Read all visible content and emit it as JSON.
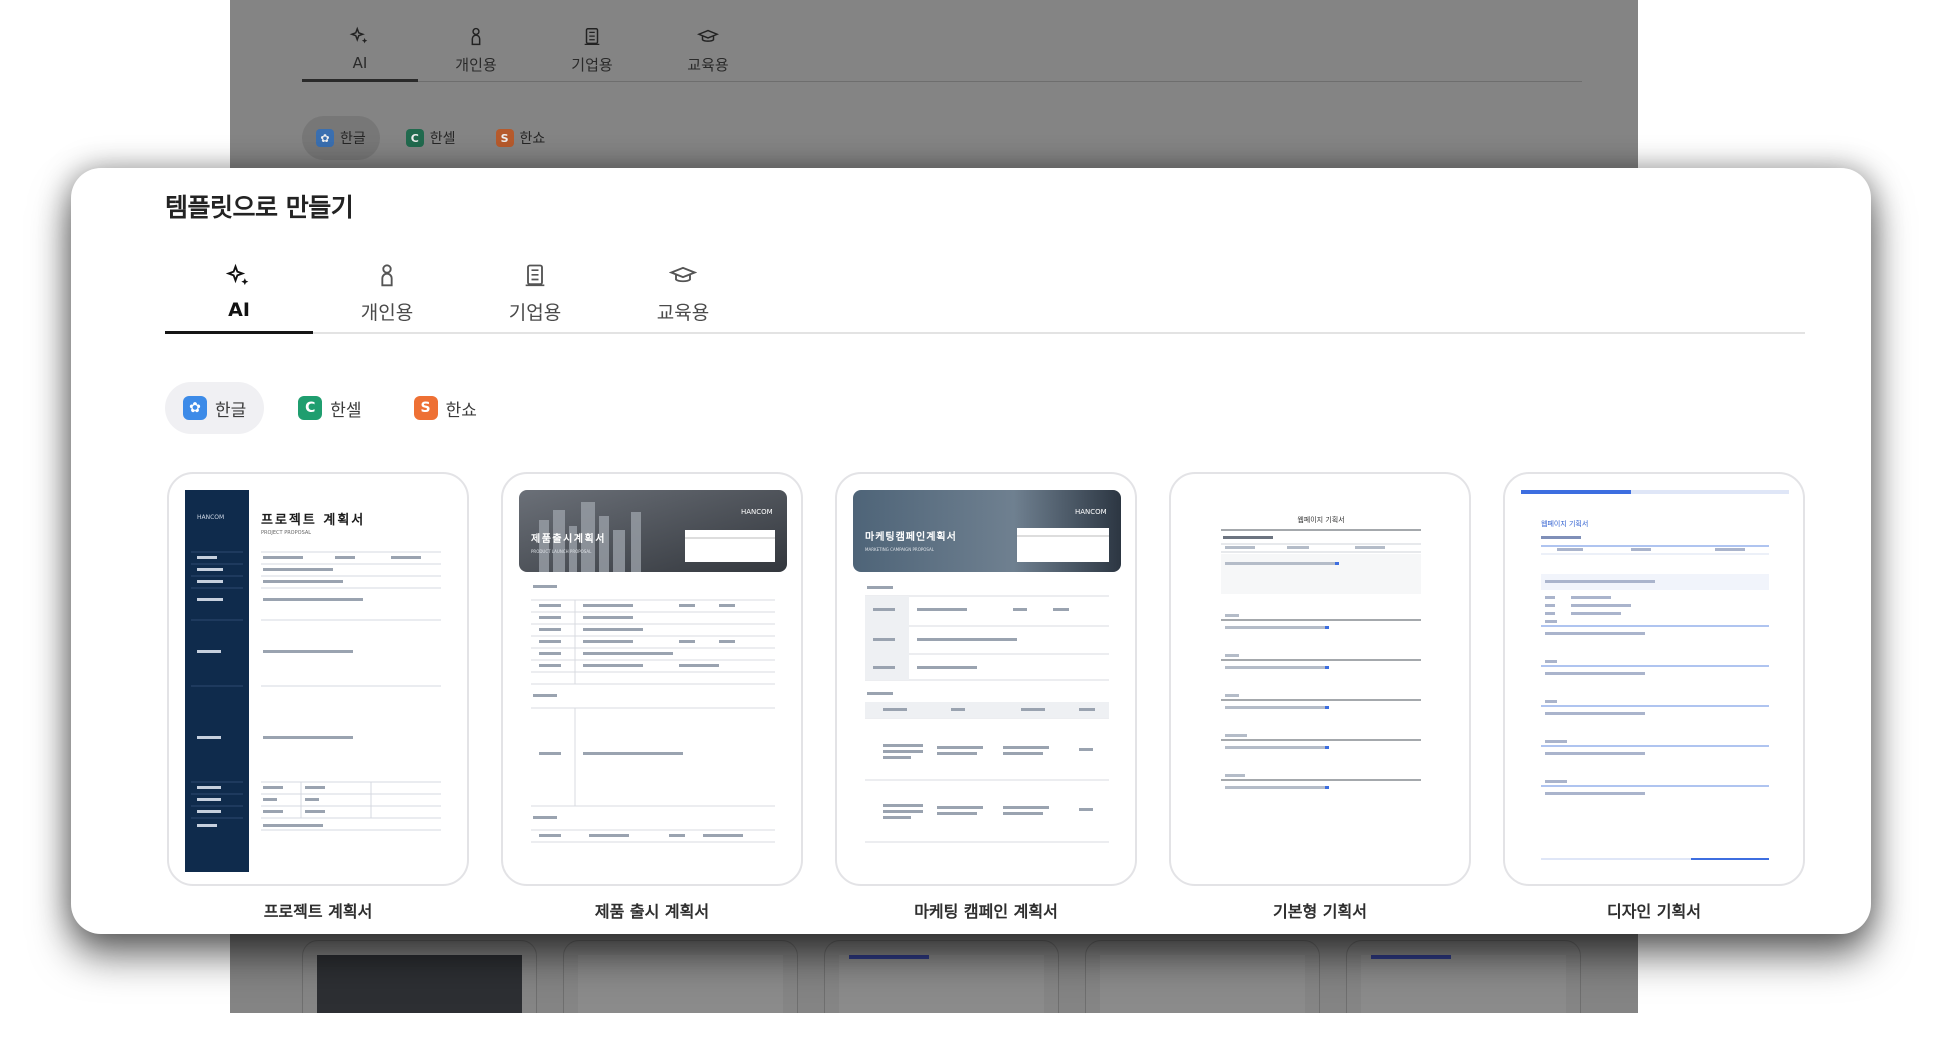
{
  "background": {
    "tabs": [
      {
        "label": "AI",
        "icon": "sparkle-icon"
      },
      {
        "label": "개인용",
        "icon": "person-icon"
      },
      {
        "label": "기업용",
        "icon": "building-icon"
      },
      {
        "label": "교육용",
        "icon": "graduation-cap-icon"
      }
    ],
    "apps": [
      {
        "label": "한글",
        "badge": "✿",
        "color": "#3a6fb0"
      },
      {
        "label": "한셀",
        "badge": "C",
        "color": "#216a4e"
      },
      {
        "label": "한쇼",
        "badge": "S",
        "color": "#b65a2c"
      }
    ]
  },
  "modal": {
    "title": "템플릿으로 만들기",
    "tabs": [
      {
        "label": "AI",
        "icon": "sparkle-icon",
        "active": true
      },
      {
        "label": "개인용",
        "icon": "person-icon",
        "active": false
      },
      {
        "label": "기업용",
        "icon": "building-icon",
        "active": false
      },
      {
        "label": "교육용",
        "icon": "graduation-cap-icon",
        "active": false
      }
    ],
    "apps": [
      {
        "label": "한글",
        "badge": "✿",
        "color": "#3d8be8",
        "active": true
      },
      {
        "label": "한셀",
        "badge": "C",
        "color": "#1f9e6f",
        "active": false
      },
      {
        "label": "한쇼",
        "badge": "S",
        "color": "#ee7034",
        "active": false
      }
    ],
    "templates": [
      {
        "label": "프로젝트 계획서",
        "doc_title": "프로젝트 계획서",
        "doc_subtitle": "PROJECT PROPOSAL",
        "brand": "HANCOM"
      },
      {
        "label": "제품 출시 계획서",
        "doc_title": "제품출시계획서",
        "doc_subtitle": "PRODUCT LAUNCH PROPOSAL",
        "brand": "HANCOM"
      },
      {
        "label": "마케팅 캠페인 계획서",
        "doc_title": "마케팅캠페인계획서",
        "doc_subtitle": "MARKETING CAMPAIGN PROPOSAL",
        "brand": "HANCOM"
      },
      {
        "label": "기본형 기획서",
        "doc_title": "웹페이지 기획서"
      },
      {
        "label": "디자인 기획서",
        "doc_title": "웹페이지 기획서"
      }
    ]
  },
  "colors": {
    "accent_dark": "#121212",
    "navy": "#0f2b4c",
    "blue_line": "#3d6ee0",
    "overlay": "#848484"
  }
}
